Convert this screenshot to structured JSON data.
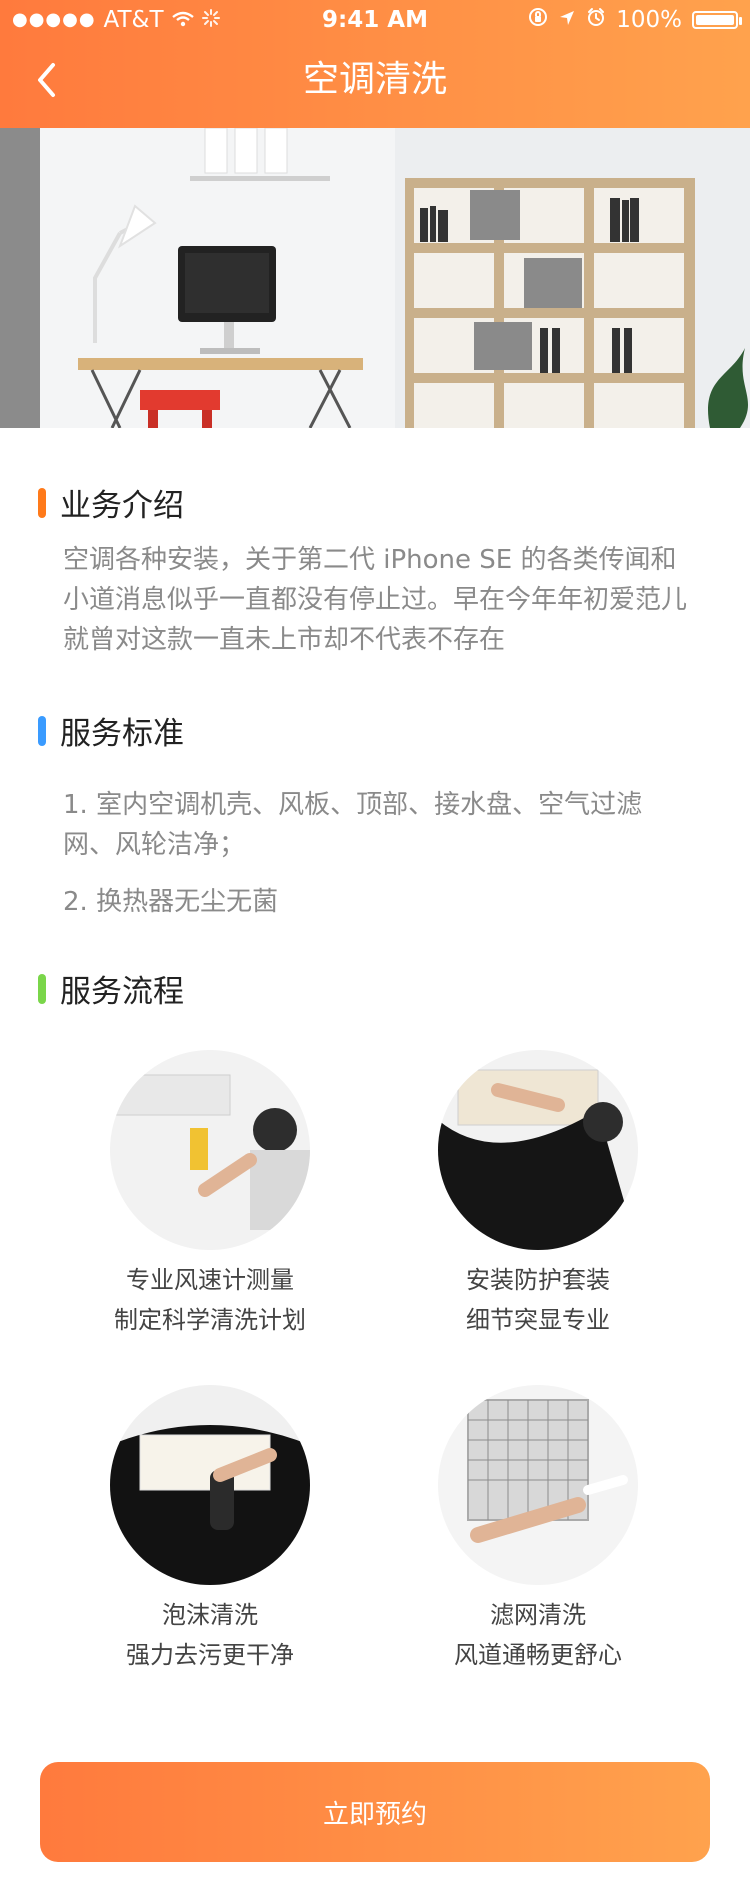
{
  "status_bar": {
    "carrier": "AT&T",
    "time": "9:41 AM",
    "battery": "100%"
  },
  "header": {
    "title": "空调清洗"
  },
  "intro": {
    "title": "业务介绍",
    "text": "空调各种安装，关于第二代 iPhone SE 的各类传闻和小道消息似乎一直都没有停止过。早在今年年初爱范儿就曾对这款一直未上市却不代表不存在"
  },
  "standard": {
    "title": "服务标准",
    "items": [
      "1. 室内空调机壳、风板、顶部、接水盘、空气过滤网、风轮洁净；",
      "2. 换热器无尘无菌"
    ]
  },
  "process": {
    "title": "服务流程",
    "steps": [
      {
        "line1": "专业风速计测量",
        "line2": "制定科学清洗计划"
      },
      {
        "line1": "安装防护套装",
        "line2": "细节突显专业"
      },
      {
        "line1": "泡沫清洗",
        "line2": "强力去污更干净"
      },
      {
        "line1": "滤网清洗",
        "line2": "风道通畅更舒心"
      }
    ]
  },
  "cta": {
    "label": "立即预约"
  },
  "colors": {
    "accent": "#ff7a3d",
    "accent2": "#ffa24d",
    "bar_orange": "#ff7a1a",
    "bar_blue": "#3a9bff",
    "bar_green": "#7ad64a"
  }
}
